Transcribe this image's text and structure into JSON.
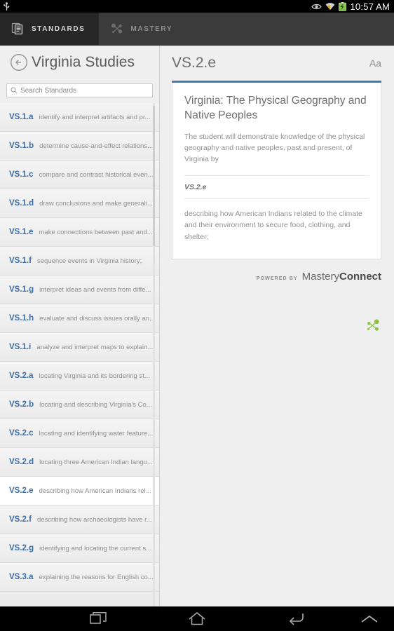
{
  "statusbar": {
    "icons": [
      "usb-icon",
      "eye-icon",
      "wifi-icon",
      "battery-icon"
    ],
    "clock": "10:57 AM"
  },
  "tabs": [
    {
      "label": "STANDARDS",
      "icon": "documents-icon",
      "active": true
    },
    {
      "label": "MASTERY",
      "icon": "network-nodes-icon",
      "active": false
    }
  ],
  "sidebar": {
    "back_icon": "circle-back-arrow-icon",
    "title": "Virginia Studies",
    "search": {
      "icon": "search-icon",
      "placeholder": "Search Standards",
      "value": ""
    },
    "items": [
      {
        "code": "VS.1.a",
        "desc": "identify and interpret artifacts and pr...",
        "selected": false
      },
      {
        "code": "VS.1.b",
        "desc": "determine cause-and-effect relations...",
        "selected": false
      },
      {
        "code": "VS.1.c",
        "desc": "compare and contrast historical even...",
        "selected": false
      },
      {
        "code": "VS.1.d",
        "desc": "draw conclusions and make generali...",
        "selected": false
      },
      {
        "code": "VS.1.e",
        "desc": "make connections between past and...",
        "selected": false
      },
      {
        "code": "VS.1.f",
        "desc": "sequence events in Virginia history;",
        "selected": false
      },
      {
        "code": "VS.1.g",
        "desc": "interpret ideas and events from diffe...",
        "selected": false
      },
      {
        "code": "VS.1.h",
        "desc": "evaluate and discuss issues orally an...",
        "selected": false
      },
      {
        "code": "VS.1.i",
        "desc": "analyze and interpret maps to explain...",
        "selected": false
      },
      {
        "code": "VS.2.a",
        "desc": "locating Virginia and its bordering st...",
        "selected": false
      },
      {
        "code": "VS.2.b",
        "desc": "locating and describing Virginia's Co...",
        "selected": false
      },
      {
        "code": "VS.2.c",
        "desc": "locating and identifying water feature...",
        "selected": false
      },
      {
        "code": "VS.2.d",
        "desc": "locating three American Indian langu...",
        "selected": false
      },
      {
        "code": "VS.2.e",
        "desc": "describing how American Indians rel...",
        "selected": true
      },
      {
        "code": "VS.2.f",
        "desc": "describing how archaeologists have r...",
        "selected": false
      },
      {
        "code": "VS.2.g",
        "desc": "identifying and locating the current s...",
        "selected": false
      },
      {
        "code": "VS.3.a",
        "desc": "explaining the reasons for English co...",
        "selected": false
      }
    ]
  },
  "detail": {
    "code": "VS.2.e",
    "font_button": "Aa",
    "accent_color": "#3e7cb1",
    "card": {
      "title": "Virginia: The Physical Geography and Native Peoples",
      "subtitle": "The student will demonstrate knowledge of the physical geography and native peoples, past and present, of Virginia by",
      "standard_code": "VS.2.e",
      "body": "describing how American Indians related to the climate and their environment to secure food, clothing, and shelter;"
    }
  },
  "brand": {
    "powered_by": "POWERED BY",
    "name_light": "Mastery",
    "name_bold": "Connect",
    "mark": "network-nodes-logo-icon",
    "mark_color": "#8cc63f"
  },
  "navbar": {
    "buttons": [
      {
        "name": "recents-icon",
        "label": "Recents"
      },
      {
        "name": "home-icon",
        "label": "Home"
      },
      {
        "name": "back-icon",
        "label": "Back"
      },
      {
        "name": "chevron-up-icon",
        "label": "Expand"
      }
    ]
  }
}
